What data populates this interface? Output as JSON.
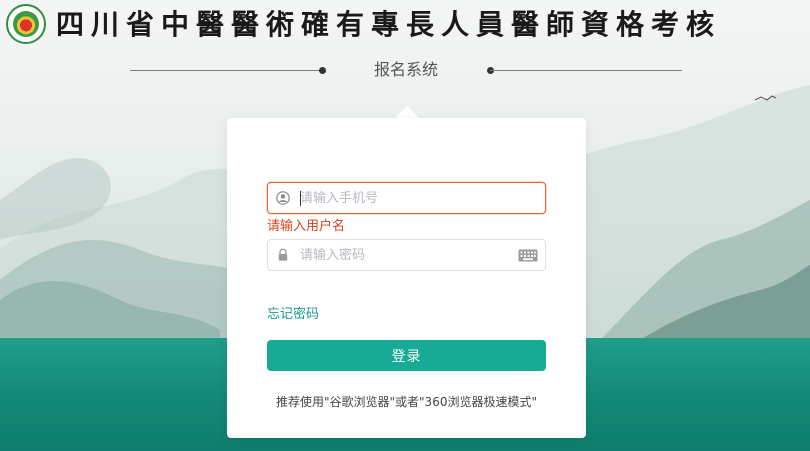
{
  "header": {
    "title": "四川省中醫醫術確有專長人員醫師資格考核",
    "subtitle": "报名系统"
  },
  "login": {
    "phone_placeholder": "请输入手机号",
    "phone_value": "",
    "phone_error": "请输入用户名",
    "password_placeholder": "请输入密码",
    "password_value": "",
    "forgot_label": "忘记密码",
    "submit_label": "登录",
    "browser_tip": "推荐使用\"谷歌浏览器\"或者\"360浏览器极速模式\""
  },
  "icons": {
    "phone_field": "user-icon",
    "password_field": "lock-icon",
    "password_keyboard": "keyboard-icon"
  },
  "colors": {
    "accent": "#17ab95",
    "error": "#d9421c",
    "water": "#148a78"
  }
}
